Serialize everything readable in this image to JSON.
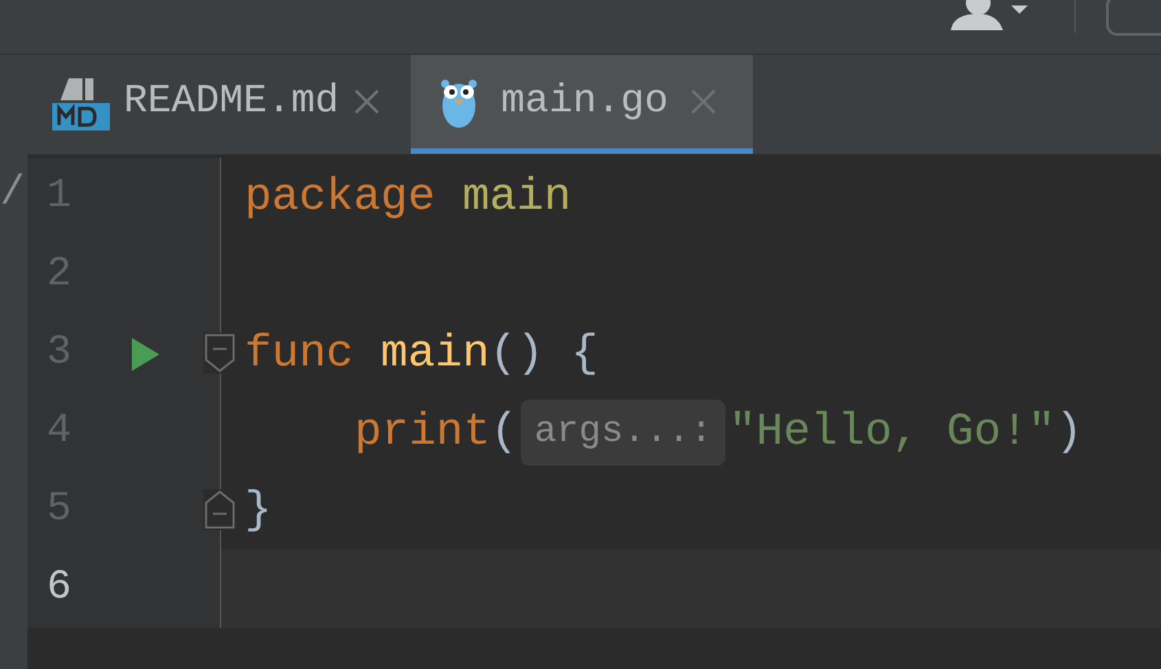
{
  "side_panel": {
    "text": "/"
  },
  "tabs": [
    {
      "label": "README.md",
      "kind": "markdown",
      "selected": false
    },
    {
      "label": "main.go",
      "kind": "go",
      "selected": true
    }
  ],
  "editor": {
    "lines": [
      {
        "number": "1",
        "current": false,
        "tokens": [
          {
            "kind": "keyword",
            "text": "package "
          },
          {
            "kind": "package",
            "text": "main"
          }
        ]
      },
      {
        "number": "2",
        "current": false
      },
      {
        "number": "3",
        "current": false,
        "run": true,
        "fold_start": true,
        "tokens": [
          {
            "kind": "keyword",
            "text": "func "
          },
          {
            "kind": "function",
            "text": "main"
          },
          {
            "kind": "punct",
            "text": "() {"
          }
        ]
      },
      {
        "number": "4",
        "current": false,
        "indented": true,
        "tokens": [
          {
            "kind": "builtin",
            "text": "print"
          },
          {
            "kind": "punct",
            "text": "("
          },
          {
            "kind": "hint",
            "text": "args...:"
          },
          {
            "kind": "string",
            "text": "\"Hello, Go!\""
          },
          {
            "kind": "punct",
            "text": ")"
          }
        ]
      },
      {
        "number": "5",
        "current": false,
        "fold_end": true,
        "tokens": [
          {
            "kind": "punct",
            "text": "}"
          }
        ]
      },
      {
        "number": "6",
        "current": true
      }
    ]
  }
}
